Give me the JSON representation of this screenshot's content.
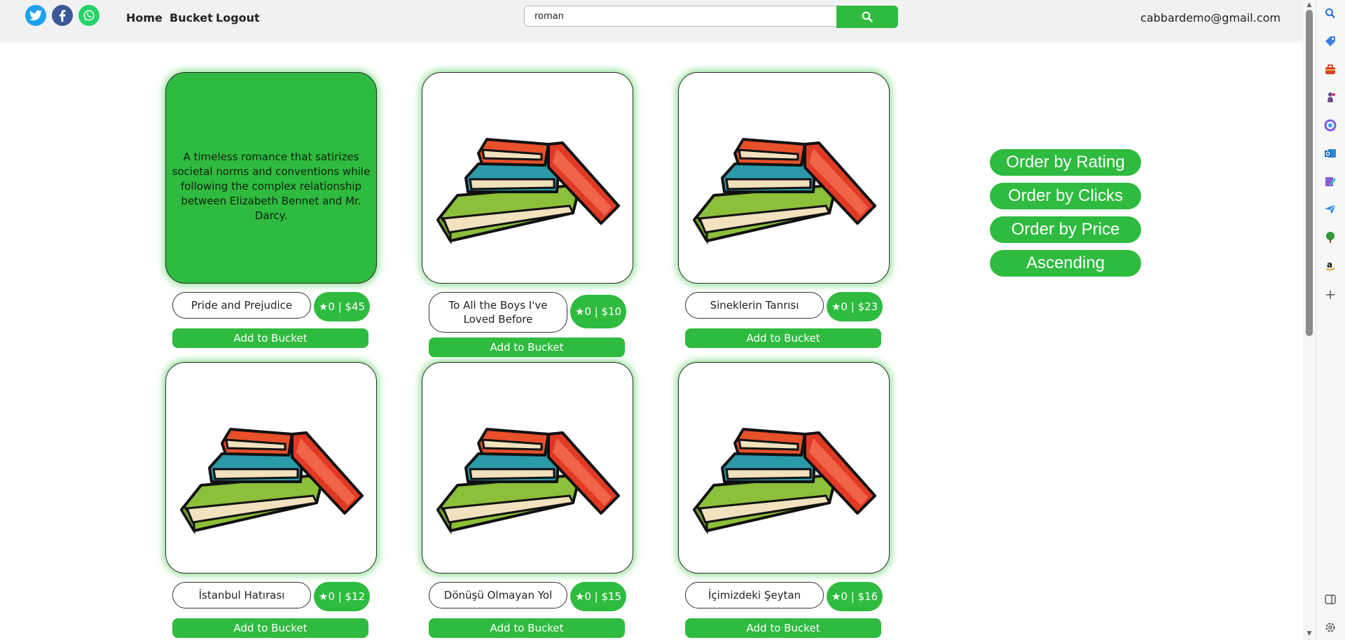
{
  "header": {
    "social": [
      {
        "name": "twitter-icon",
        "color": "#1da1f2"
      },
      {
        "name": "facebook-icon",
        "color": "#3b5998"
      },
      {
        "name": "whatsapp-icon",
        "color": "#25d366"
      }
    ],
    "nav": {
      "home": "Home",
      "bucket": "Bucket",
      "logout": "Logout"
    },
    "search": {
      "value": "roman",
      "button_icon": "search-icon"
    },
    "user_email": "cabbardemo@gmail.com"
  },
  "products": [
    {
      "title": "Pride and Prejudice",
      "rating_price": "★0 | $45",
      "add_label": "Add to Bucket",
      "description": "A timeless romance that satirizes societal norms and conventions while following the complex relationship between Elizabeth Bennet and Mr. Darcy."
    },
    {
      "title": "To All the Boys I've Loved Before",
      "rating_price": "★0 | $10",
      "add_label": "Add to Bucket"
    },
    {
      "title": "Sineklerin Tanrısı",
      "rating_price": "★0 | $23",
      "add_label": "Add to Bucket"
    },
    {
      "title": "İstanbul Hatırası",
      "rating_price": "★0 | $12",
      "add_label": "Add to Bucket"
    },
    {
      "title": "Dönüşü Olmayan Yol",
      "rating_price": "★0 | $15",
      "add_label": "Add to Bucket"
    },
    {
      "title": "İçimizdeki Şeytan",
      "rating_price": "★0 | $16",
      "add_label": "Add to Bucket"
    }
  ],
  "ordering": {
    "rating": "Order by Rating",
    "clicks": "Order by Clicks",
    "price": "Order by Price",
    "direction": "Ascending"
  },
  "colors": {
    "accent": "#2ebb3f",
    "book_orange": "#e8502a",
    "book_teal": "#2a9aa8",
    "book_green": "#8cbf3a"
  },
  "browser_sidebar": [
    "search-icon",
    "tag-icon",
    "toolbox-icon",
    "chess-icon",
    "office-icon",
    "outlook-icon",
    "edit-icon",
    "send-icon",
    "tree-icon",
    "amazon-icon",
    "add-icon",
    "split-screen-icon",
    "settings-icon"
  ]
}
